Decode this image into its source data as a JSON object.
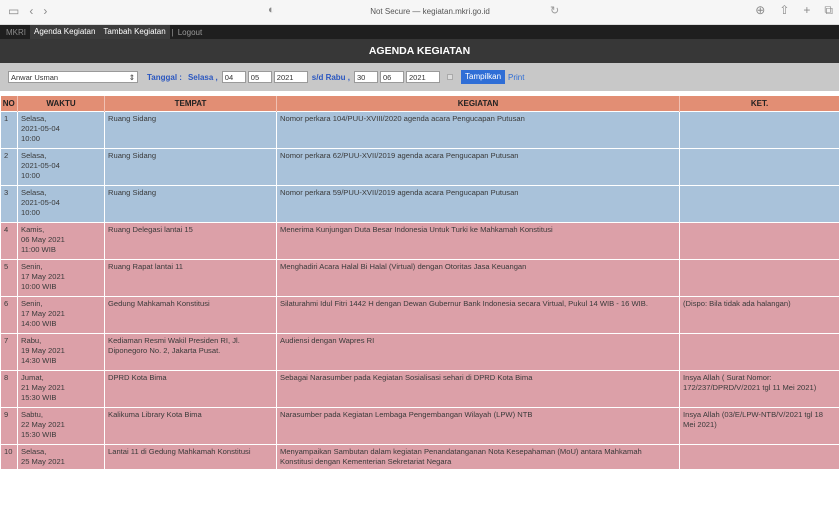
{
  "browser": {
    "address": "Not Secure — kegiatan.mkri.go.id"
  },
  "nav": {
    "brand": "MKRI",
    "items": [
      "Agenda Kegiatan",
      "Tambah Kegiatan"
    ],
    "separator": "|",
    "logout": "Logout"
  },
  "title": "AGENDA KEGIATAN",
  "filter": {
    "person": "Anwar Usman",
    "tanggal_label": "Tanggal :",
    "start_day_name": "Selasa ,",
    "start_day": "04",
    "start_month": "05",
    "start_year": "2021",
    "until_label": "s/d Rabu ,",
    "end_day": "30",
    "end_month": "06",
    "end_year": "2021",
    "show_button": "Tampilkan",
    "print_link": "Print"
  },
  "table": {
    "headers": [
      "NO",
      "WAKTU",
      "TEMPAT",
      "KEGIATAN",
      "KET."
    ],
    "rows": [
      {
        "no": "1",
        "waktu": [
          "Selasa,",
          "2021-05-04",
          "10:00"
        ],
        "tempat": "Ruang Sidang",
        "kegiatan": "Nomor perkara 104/PUU-XVIII/2020 agenda acara Pengucapan Putusan",
        "ket": "",
        "color": "blue"
      },
      {
        "no": "2",
        "waktu": [
          "Selasa,",
          "2021-05-04",
          "10:00"
        ],
        "tempat": "Ruang Sidang",
        "kegiatan": "Nomor perkara 62/PUU-XVII/2019 agenda acara Pengucapan Putusan",
        "ket": "",
        "color": "blue"
      },
      {
        "no": "3",
        "waktu": [
          "Selasa,",
          "2021-05-04",
          "10:00"
        ],
        "tempat": "Ruang Sidang",
        "kegiatan": "Nomor perkara 59/PUU-XVII/2019 agenda acara Pengucapan Putusan",
        "ket": "",
        "color": "blue"
      },
      {
        "no": "4",
        "waktu": [
          "Kamis,",
          "06 May 2021",
          "11:00 WIB"
        ],
        "tempat": "Ruang Delegasi lantai 15",
        "kegiatan": "Menerima Kunjungan Duta Besar Indonesia Untuk Turki ke Mahkamah Konstitusi",
        "ket": "",
        "color": "red"
      },
      {
        "no": "5",
        "waktu": [
          "Senin,",
          "17 May 2021",
          "10:00 WIB"
        ],
        "tempat": "Ruang Rapat lantai 11",
        "kegiatan": "Menghadiri Acara Halal Bi Halal (Virtual) dengan Otoritas Jasa Keuangan",
        "ket": "",
        "color": "red"
      },
      {
        "no": "6",
        "waktu": [
          "Senin,",
          "17 May 2021",
          "14:00 WIB"
        ],
        "tempat": "Gedung Mahkamah Konstitusi",
        "kegiatan": "Silaturahmi Idul Fitri 1442 H dengan Dewan Gubernur Bank Indonesia secara Virtual, Pukul 14 WIB - 16 WIB.",
        "ket": "(Dispo: Bila tidak ada halangan)",
        "color": "red"
      },
      {
        "no": "7",
        "waktu": [
          "Rabu,",
          "19 May 2021",
          "14:30 WIB"
        ],
        "tempat": "Kediaman Resmi Wakil Presiden RI, Jl. Diponegoro No. 2, Jakarta Pusat.",
        "kegiatan": "Audiensi dengan Wapres RI",
        "ket": "",
        "color": "red"
      },
      {
        "no": "8",
        "waktu": [
          "Jumat,",
          "21 May 2021",
          "15:30 WIB"
        ],
        "tempat": "DPRD Kota Bima",
        "kegiatan": "Sebagai Narasumber pada Kegiatan Sosialisasi sehari di DPRD Kota Bima",
        "ket": "Insya Allah ( Surat Nomor: 172/237/DPRD/V/2021 tgl 11 Mei 2021)",
        "color": "red"
      },
      {
        "no": "9",
        "waktu": [
          "Sabtu,",
          "22 May 2021",
          "15:30 WIB"
        ],
        "tempat": "Kalikuma Library Kota Bima",
        "kegiatan": "Narasumber pada Kegiatan Lembaga Pengembangan Wilayah (LPW) NTB",
        "ket": "Insya Allah (03/E/LPW-NTB/V/2021 tgl 18 Mei 2021)",
        "color": "red"
      },
      {
        "no": "10",
        "waktu": [
          "Selasa,",
          "25 May 2021"
        ],
        "tempat": "Lantai 11 di Gedung Mahkamah Konstitusi",
        "kegiatan": "Menyampaikan Sambutan dalam kegiatan Penandatanganan Nota Kesepahaman (MoU) antara Mahkamah Konstitusi dengan Kementerian Sekretariat Negara",
        "ket": "",
        "color": "red"
      }
    ]
  }
}
